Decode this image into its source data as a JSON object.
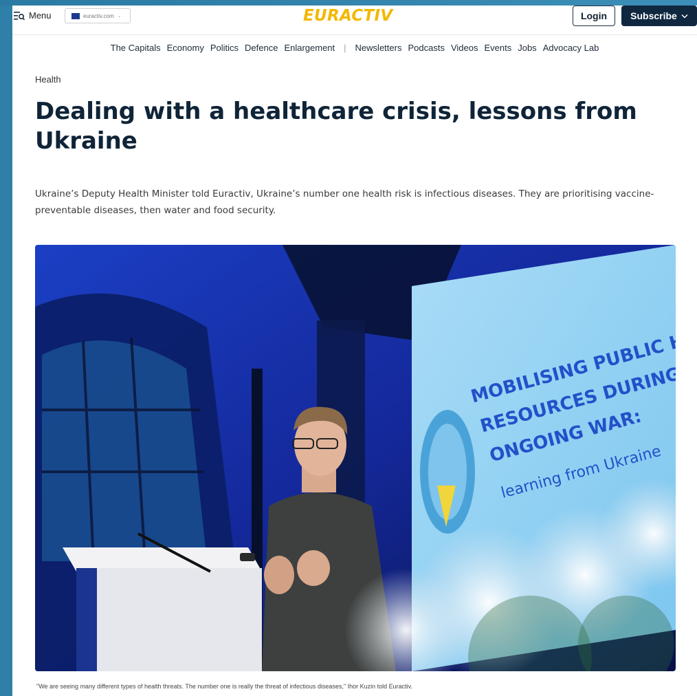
{
  "header": {
    "menu_label": "Menu",
    "domain_chip": "euractiv.com",
    "logo": "EURACTIV",
    "login_label": "Login",
    "subscribe_label": "Subscribe"
  },
  "nav": {
    "primary": [
      "The Capitals",
      "Economy",
      "Politics",
      "Defence",
      "Enlargement"
    ],
    "separator": "|",
    "secondary": [
      "Newsletters",
      "Podcasts",
      "Videos",
      "Events",
      "Jobs",
      "Advocacy Lab"
    ]
  },
  "article": {
    "category": "Health",
    "headline": "Dealing with a healthcare crisis, lessons from Ukraine",
    "standfirst": "Ukraine’s Deputy Health Minister told Euractiv, Ukraine’s number one health risk is infectious diseases. They are prioritising vaccine-preventable diseases, then water and food security.",
    "image": {
      "screen_text": [
        "MOBILISING PUBLIC HEALTH",
        "RESOURCES DURING THE",
        "ONGOING WAR:",
        "learning from Ukraine"
      ]
    },
    "caption": "\"We are seeing many different types of health threats. The number one is really the threat of infectious diseases,\" Ihor Kuzin told Euractiv."
  },
  "colors": {
    "logo": "#f2b800",
    "subscribe_bg": "#0f2840",
    "headline": "#0f2438",
    "frame": "#2f80a8"
  },
  "icons": {
    "menu": "menu-search-icon",
    "subscribe": "chevron-down-icon"
  }
}
